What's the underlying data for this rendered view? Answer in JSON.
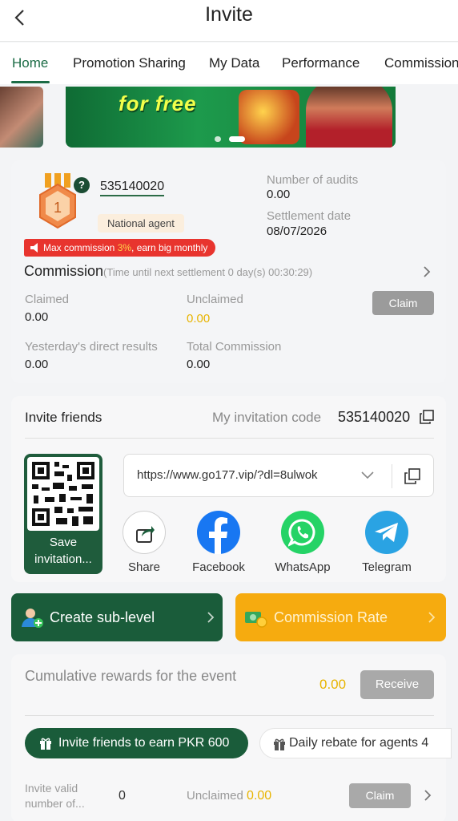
{
  "header": {
    "title": "Invite"
  },
  "tabs": [
    "Home",
    "Promotion Sharing",
    "My Data",
    "Performance",
    "Commission"
  ],
  "banner": {
    "text": "for free"
  },
  "agent": {
    "level": "1",
    "user_id": "535140020",
    "type": "National agent",
    "audits_label": "Number of audits",
    "audits_value": "0.00",
    "settlement_label": "Settlement date",
    "settlement_value": "08/07/2026",
    "promo_pre": "Max commission ",
    "promo_pct": "3%",
    "promo_post": ", earn big monthly"
  },
  "commission": {
    "title": "Commission",
    "subtitle": "(Time until next settlement  0 day(s) 00:30:29)",
    "claimed_label": "Claimed",
    "claimed_value": "0.00",
    "unclaimed_label": "Unclaimed",
    "unclaimed_value": "0.00",
    "claim_button": "Claim",
    "yesterday_label": "Yesterday's direct results",
    "yesterday_value": "0.00",
    "total_label": "Total Commission",
    "total_value": "0.00"
  },
  "invite": {
    "title": "Invite friends",
    "code_label": "My invitation code",
    "code_value": "535140020",
    "save_label": "Save invitation...",
    "link": "https://www.go177.vip/?dl=8ulwok",
    "share": [
      {
        "label": "Share",
        "icon": "share-icon",
        "color": "#ffffff"
      },
      {
        "label": "Facebook",
        "icon": "facebook-icon",
        "color": "#1877f2"
      },
      {
        "label": "WhatsApp",
        "icon": "whatsapp-icon",
        "color": "#25d366"
      },
      {
        "label": "Telegram",
        "icon": "telegram-icon",
        "color": "#2aa3e3"
      }
    ]
  },
  "actions": {
    "create_sublevel": "Create sub-level",
    "commission_rate": "Commission Rate"
  },
  "rewards": {
    "cumulative_label": "Cumulative rewards for the event",
    "cumulative_value": "0.00",
    "receive_button": "Receive",
    "pill_invite": "Invite friends to earn PKR 600",
    "pill_rebate": "Daily rebate for agents 4",
    "valid_label": "Invite valid number of...",
    "valid_value": "0",
    "unclaimed_label": "Unclaimed",
    "unclaimed_value": "0.00",
    "claim_button": "Claim"
  },
  "colors": {
    "brand_green": "#1a5c3a",
    "accent_orange": "#f6ab0f",
    "money_yellow": "#e8b400",
    "promo_red": "#e8342e"
  }
}
